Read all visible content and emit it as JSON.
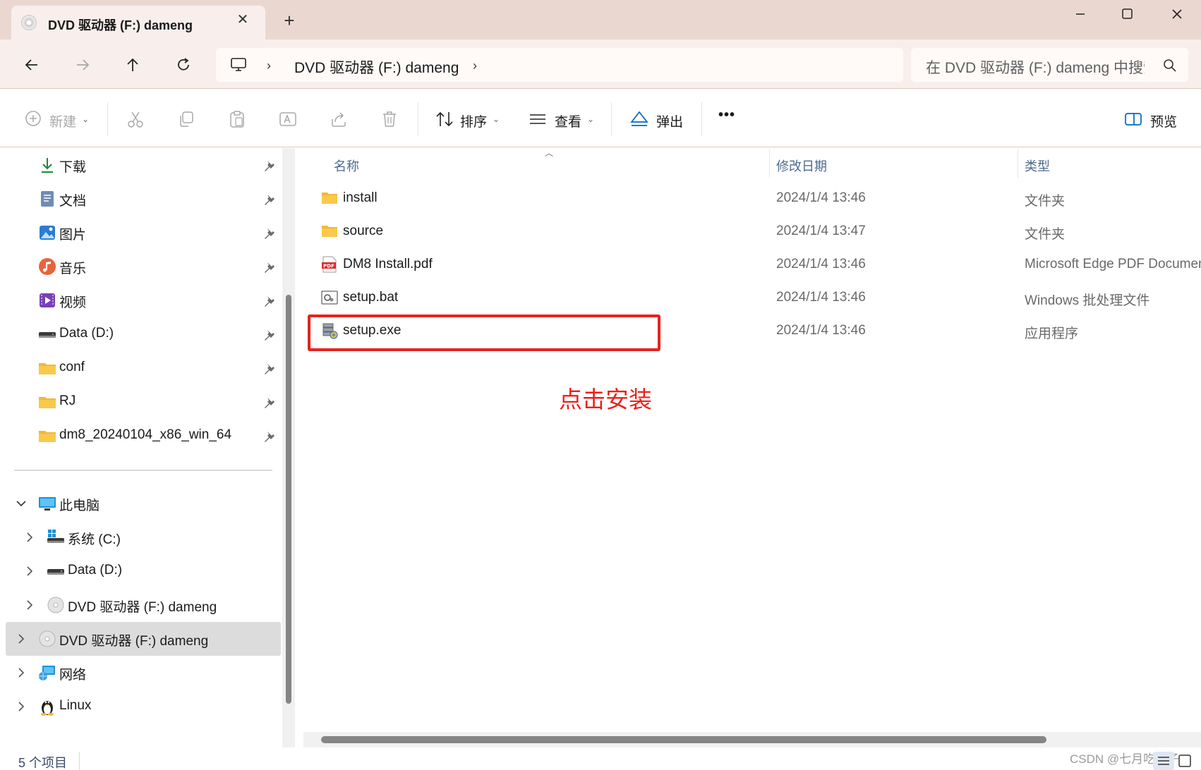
{
  "window": {
    "tab_title": "DVD 驱动器 (F:) dameng",
    "tab_close_icon": "close-icon",
    "new_tab_icon": "plus-icon"
  },
  "navigation": {
    "address_path": "DVD 驱动器 (F:) dameng",
    "search_placeholder": "在 DVD 驱动器 (F:) dameng 中搜索"
  },
  "toolbar": {
    "new_label": "新建",
    "sort_label": "排序",
    "view_label": "查看",
    "eject_label": "弹出",
    "more_label": "•••",
    "preview_label": "预览"
  },
  "sidebar": {
    "quick_access": [
      {
        "label": "下载",
        "icon": "download-icon"
      },
      {
        "label": "文档",
        "icon": "document-icon"
      },
      {
        "label": "图片",
        "icon": "pictures-icon"
      },
      {
        "label": "音乐",
        "icon": "music-icon"
      },
      {
        "label": "视频",
        "icon": "video-icon"
      },
      {
        "label": "Data (D:)",
        "icon": "drive-icon"
      },
      {
        "label": "conf",
        "icon": "folder-icon"
      },
      {
        "label": "RJ",
        "icon": "folder-icon"
      },
      {
        "label": "dm8_20240104_x86_win_64",
        "icon": "folder-icon"
      }
    ],
    "this_pc": "此电脑",
    "drives": [
      {
        "label": "系统 (C:)",
        "icon": "windows-drive-icon"
      },
      {
        "label": "Data (D:)",
        "icon": "drive-icon"
      },
      {
        "label": "DVD 驱动器 (F:) dameng",
        "icon": "dvd-icon"
      }
    ],
    "dvd_root": "DVD 驱动器 (F:) dameng",
    "network": "网络",
    "linux": "Linux"
  },
  "file_list": {
    "columns": {
      "name": "名称",
      "modified": "修改日期",
      "type": "类型"
    },
    "rows": [
      {
        "name": "install",
        "modified": "2024/1/4 13:46",
        "type": "文件夹",
        "icon": "folder-icon"
      },
      {
        "name": "source",
        "modified": "2024/1/4 13:47",
        "type": "文件夹",
        "icon": "folder-icon"
      },
      {
        "name": "DM8 Install.pdf",
        "modified": "2024/1/4 13:46",
        "type": "Microsoft Edge PDF Document",
        "icon": "pdf-icon"
      },
      {
        "name": "setup.bat",
        "modified": "2024/1/4 13:46",
        "type": "Windows 批处理文件",
        "icon": "batch-file-icon"
      },
      {
        "name": "setup.exe",
        "modified": "2024/1/4 13:46",
        "type": "应用程序",
        "icon": "installer-icon"
      }
    ]
  },
  "annotation": {
    "text": "点击安装",
    "color": "#e8221b"
  },
  "status": {
    "item_count": "5 个项目",
    "watermark": "CSDN @七月吃橘子"
  },
  "colors": {
    "titlebar": "#ead8d0",
    "accent": "#0067c0",
    "folder": "#f8c94a"
  }
}
